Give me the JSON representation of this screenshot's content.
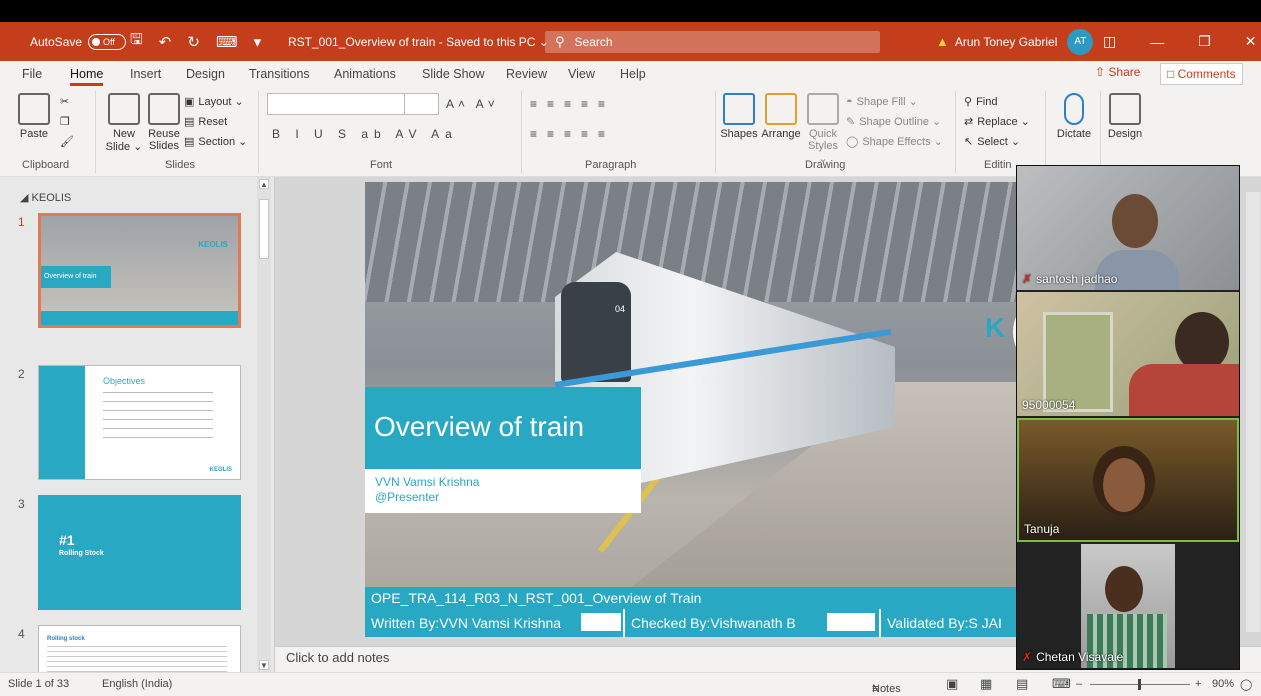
{
  "titlebar": {
    "autosave_label": "AutoSave",
    "autosave_state": "Off",
    "document_title": "RST_001_Overview of train  -  Saved to this PC  ⌄",
    "search_placeholder": "Search",
    "user_name": "Arun Toney Gabriel",
    "user_initials": "AT"
  },
  "tabs": [
    "File",
    "Home",
    "Insert",
    "Design",
    "Transitions",
    "Animations",
    "Slide Show",
    "Review",
    "View",
    "Help"
  ],
  "active_tab": "Home",
  "share_label": "Share",
  "comments_label": "Comments",
  "ribbon": {
    "clipboard": {
      "paste": "Paste",
      "label": "Clipboard"
    },
    "slides": {
      "new_slide": "New Slide ⌄",
      "reuse_slides": "Reuse Slides",
      "layout": "Layout ⌄",
      "reset": "Reset",
      "section": "Section ⌄",
      "label": "Slides"
    },
    "font": {
      "label": "Font",
      "row1": "A˄ A˅",
      "row2": "B I U S ab AV Aa"
    },
    "paragraph": {
      "label": "Paragraph"
    },
    "drawing": {
      "shapes": "Shapes",
      "arrange": "Arrange",
      "quick_styles": "Quick Styles ⌄",
      "shape_fill": "Shape Fill ⌄",
      "shape_outline": "Shape Outline ⌄",
      "shape_effects": "Shape Effects ⌄",
      "label": "Drawing"
    },
    "editing": {
      "find": "Find",
      "replace": "Replace ⌄",
      "select": "Select ⌄",
      "label": "Editin"
    },
    "voice": {
      "dictate": "Dictate"
    },
    "designer": {
      "design": "Design"
    }
  },
  "thumbnails": {
    "section_name": "KEOLIS",
    "slides": [
      {
        "number": "1",
        "title": "Overview of train",
        "brand": "KEOLIS"
      },
      {
        "number": "2",
        "title": "Objectives",
        "brand": "KEOLIS"
      },
      {
        "number": "3",
        "title": "#1",
        "subtitle": "Rolling Stock"
      },
      {
        "number": "4",
        "title": "Rolling stock"
      }
    ]
  },
  "slide": {
    "title": "Overview of train",
    "presenter_name": "VVN Vamsi Krishna",
    "presenter_role": "@Presenter",
    "doc_code": "OPE_TRA_114_R03_N_RST_001_Overview of Train",
    "written_by": "Written By:VVN Vamsi Krishna",
    "checked_by": "Checked By:Vishwanath B",
    "validated_by": "Validated By:S JAI",
    "train_number": "04"
  },
  "notes_placeholder": "Click to add notes",
  "status": {
    "slide_info": "Slide 1 of 33",
    "language": "English (India)",
    "notes_label": "Notes",
    "zoom": "90%"
  },
  "participants": [
    {
      "name": "santosh jadhao",
      "muted": true
    },
    {
      "name": "95000054",
      "muted": false
    },
    {
      "name": "Tanuja",
      "muted": false,
      "speaking": true
    },
    {
      "name": "Chetan Visavale",
      "muted": true
    }
  ],
  "colors": {
    "accent": "#c43e1c",
    "slide_teal": "#29a8c3",
    "speaking": "#7bbf3a"
  }
}
